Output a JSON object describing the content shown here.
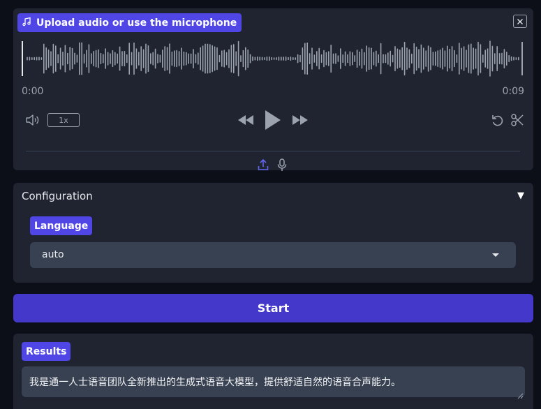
{
  "audio": {
    "badge_label": "Upload audio or use the microphone",
    "time_start": "0:00",
    "time_end": "0:09",
    "speed_label": "1x",
    "icons": {
      "badge": "music-note-icon",
      "clear": "close-icon",
      "volume": "volume-icon",
      "rewind": "rewind-icon",
      "play": "play-icon",
      "forward": "fast-forward-icon",
      "undo": "undo-icon",
      "trim": "scissors-icon",
      "upload": "upload-icon",
      "microphone": "microphone-icon"
    }
  },
  "config": {
    "title": "Configuration",
    "toggle_symbol": "▼",
    "language_label": "Language",
    "language_value": "auto"
  },
  "start_label": "Start",
  "results": {
    "label": "Results",
    "text": "我是通一人士语音团队全新推出的生成式语音大模型，提供舒适自然的语音合声能力。"
  },
  "colors": {
    "accent": "#4f46e5",
    "start_button": "#4338ca",
    "panel_bg": "#1f2430",
    "page_bg": "#0c0f17",
    "upload_icon": "#6366f1"
  }
}
